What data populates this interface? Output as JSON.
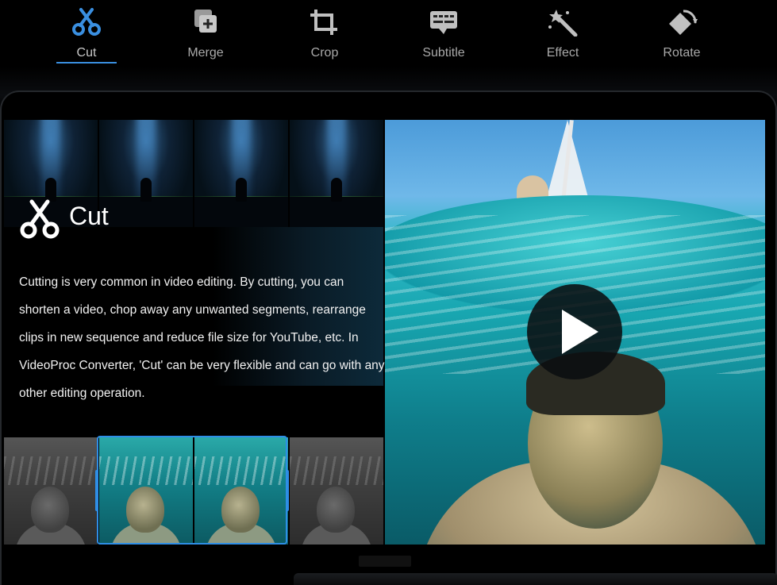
{
  "tabs": [
    {
      "label": "Cut",
      "icon": "scissors-icon",
      "active": true
    },
    {
      "label": "Merge",
      "icon": "merge-icon",
      "active": false
    },
    {
      "label": "Crop",
      "icon": "crop-icon",
      "active": false
    },
    {
      "label": "Subtitle",
      "icon": "subtitle-icon",
      "active": false
    },
    {
      "label": "Effect",
      "icon": "magic-wand-icon",
      "active": false
    },
    {
      "label": "Rotate",
      "icon": "rotate-icon",
      "active": false
    }
  ],
  "colors": {
    "accent": "#3a8fe0",
    "tab_inactive": "#a9a9a9",
    "icon_inactive": "#b0b0b0",
    "background": "#000000"
  },
  "feature": {
    "title": "Cut",
    "icon": "scissors-icon",
    "description": "Cutting is very common in video editing. By cutting, you can shorten a video, chop away any unwanted segments, rearrange clips in new sequence and reduce file size for YouTube, etc. In VideoProc Converter, 'Cut' can be very flexible and can go with any other editing operation."
  },
  "video": {
    "play_icon": "play-icon"
  }
}
